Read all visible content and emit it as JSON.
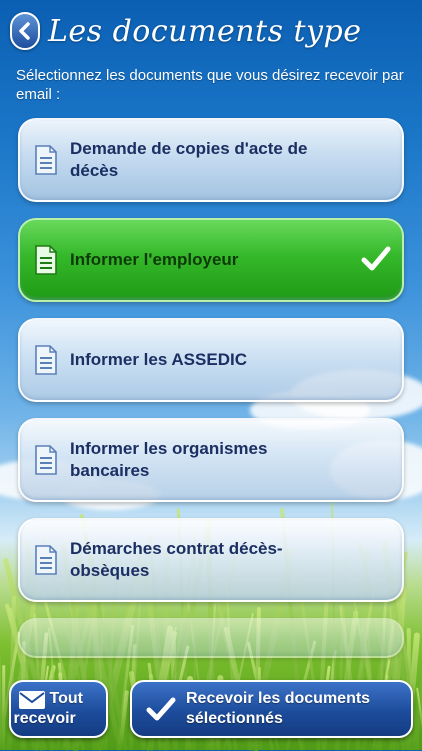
{
  "header": {
    "title": "Les documents type"
  },
  "intro": "Sélectionnez les documents que vous désirez recevoir par email :",
  "documents": [
    {
      "label": "Demande de copies d'acte de décès",
      "selected": false
    },
    {
      "label": "Informer l'employeur",
      "selected": true
    },
    {
      "label": "Informer les ASSEDIC",
      "selected": false
    },
    {
      "label": "Informer les organismes bancaires",
      "selected": false
    },
    {
      "label": "Démarches contrat décès-obsèques",
      "selected": false
    }
  ],
  "footer": {
    "receive_all_label": "Tout recevoir",
    "receive_selected_label": "Recevoir les documents sélectionnés"
  },
  "icons": {
    "back": "chevron-left-icon",
    "document": "document-icon",
    "check": "checkmark-icon",
    "mail": "envelope-icon"
  },
  "colors": {
    "selected": "#35b82a",
    "text": "#1b2f63",
    "button": "#1d4c9c"
  }
}
